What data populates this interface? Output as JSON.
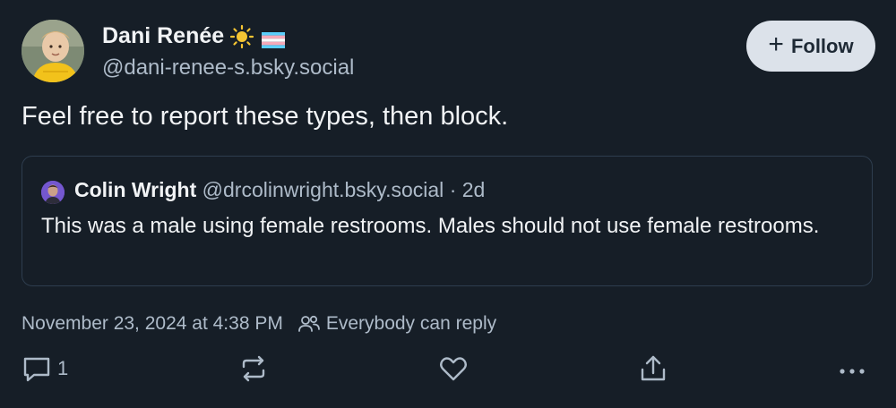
{
  "author": {
    "name": "Dani Renée",
    "handle": "@dani-renee-s.bsky.social",
    "follow_label": "Follow"
  },
  "post": {
    "text": "Feel free to report these types, then block.",
    "timestamp": "November 23, 2024 at 4:38 PM",
    "reply_setting": "Everybody can reply"
  },
  "quote": {
    "name": "Colin Wright",
    "handle": "@drcolinwright.bsky.social",
    "age": "· 2d",
    "text": "This was a male using female restrooms. Males should not use female restrooms."
  },
  "actions": {
    "reply_count": "1"
  },
  "colors": {
    "background": "#161e27",
    "primary_text": "#f1f3f5",
    "secondary_text": "#aebbc9",
    "follow_button_bg": "#dce2ea",
    "border": "#2e3d4e"
  },
  "icons": [
    "sun-icon",
    "trans-flag-icon",
    "plus-icon",
    "people-icon",
    "reply-icon",
    "repost-icon",
    "like-icon",
    "share-icon",
    "more-icon"
  ]
}
